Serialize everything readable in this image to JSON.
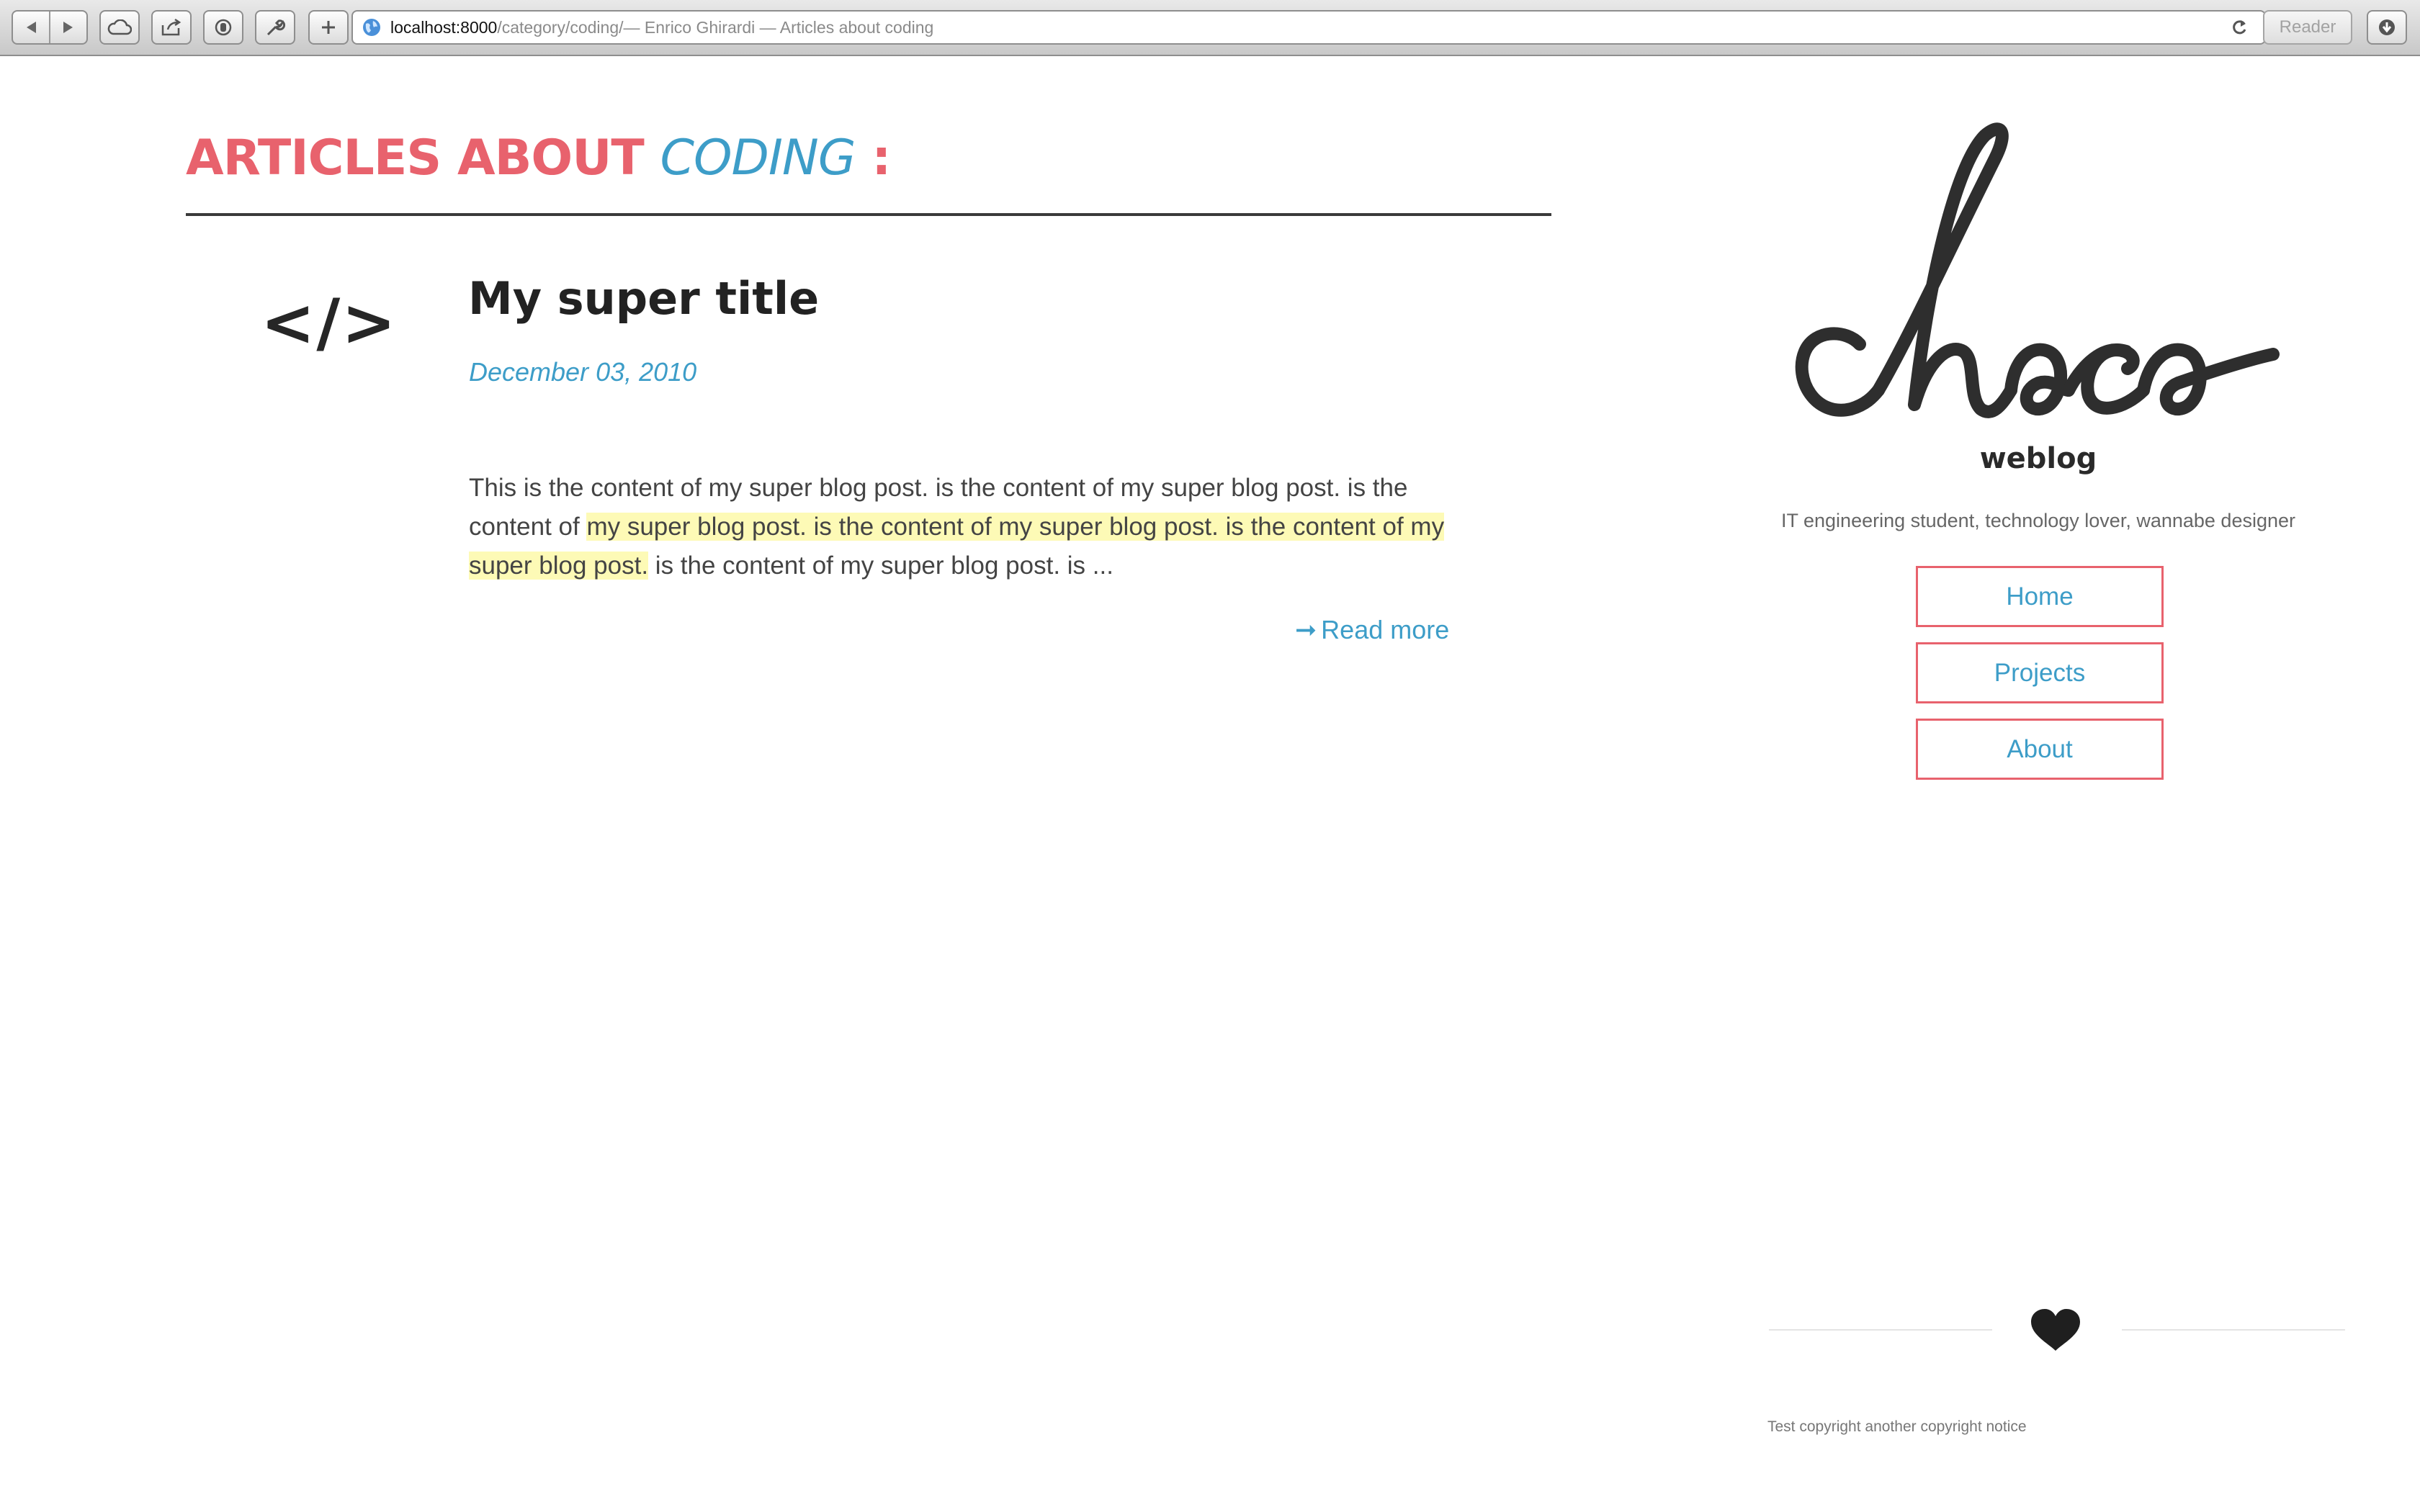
{
  "browser": {
    "url_host": "localhost:8000",
    "url_path": "/category/coding/",
    "page_title_hint": " — Enrico Ghirardi — Articles about coding",
    "reader_label": "Reader"
  },
  "main": {
    "heading_prefix": "ARTICLES ABOUT",
    "heading_category": "CODING",
    "heading_suffix": ":",
    "category_icon": "</>",
    "post": {
      "title": "My super title",
      "date": "December 03, 2010",
      "body_before": "This is the content of my super blog post. is the content of my super blog post. is the content of ",
      "body_highlight": "my super blog post. is the content of my super blog post. is the content of my super blog post.",
      "body_after": " is the content of my super blog post. is ...",
      "read_more_arrow": "➞",
      "read_more_label": "Read more"
    }
  },
  "sidebar": {
    "logo_text": "choco",
    "subtitle": "weblog",
    "tagline": "IT engineering student, technology lover, wannabe designer",
    "nav": [
      {
        "label": "Home"
      },
      {
        "label": "Projects"
      },
      {
        "label": "About"
      }
    ]
  },
  "footer": {
    "copyright": "Test copyright another copyright notice"
  },
  "colors": {
    "accent_red": "#e8626d",
    "accent_blue": "#3d9dc8",
    "highlight": "#fdfab6",
    "text_dark": "#222222"
  },
  "icons": {
    "category": "code-icon",
    "footer": "heart-icon"
  }
}
